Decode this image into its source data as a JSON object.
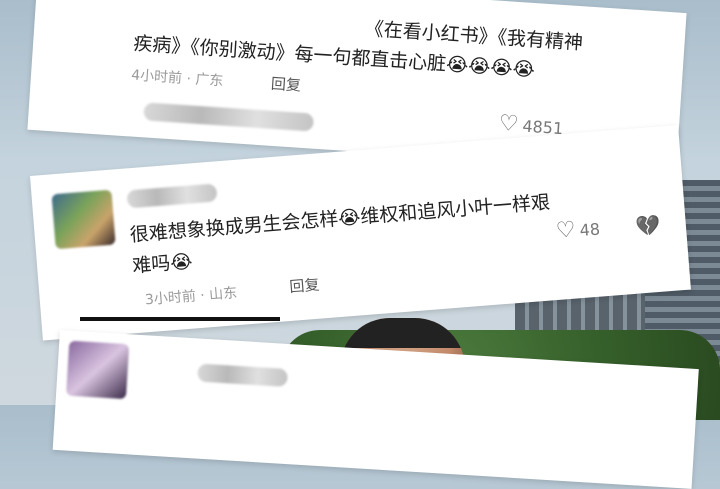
{
  "comment1": {
    "line1": "疾病》《你别激动》每一句都直击心脏😭😭😭😭",
    "line0": "《在看小红书》《我有精神",
    "time": "4小时前 · 广东",
    "reply": "回复",
    "likes": "4851"
  },
  "comment2": {
    "line1": "很难想象换成男生会怎样😭维权和追风小叶一样艰",
    "line2": "难吗😭",
    "time": "3小时前 · 山东",
    "reply": "回复",
    "likes": "48"
  },
  "icons": {
    "heart": "♡",
    "broken_heart": "💔"
  }
}
